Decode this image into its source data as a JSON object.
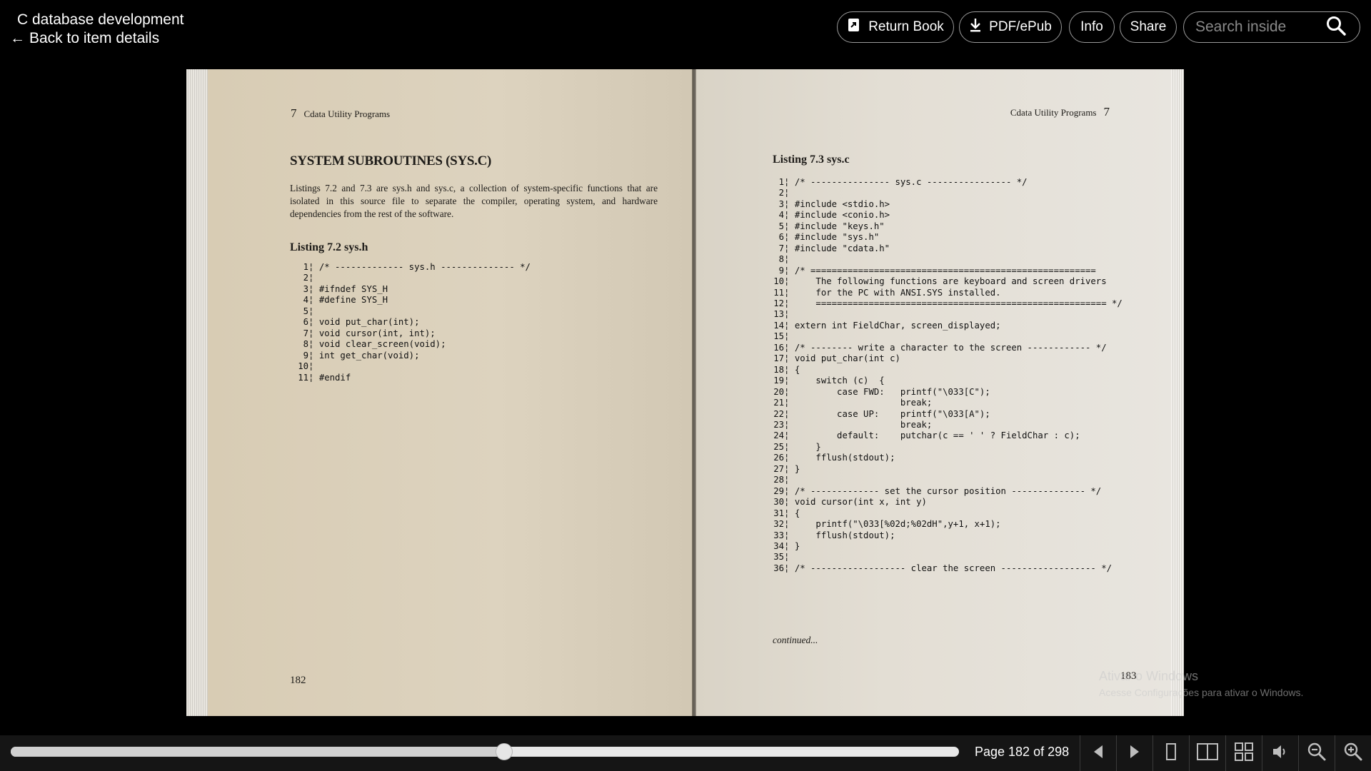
{
  "header": {
    "title": "C database development",
    "back_link": "Back to item details",
    "back_arrow": "←",
    "buttons": {
      "return_book": "Return Book",
      "pdf_epub": "PDF/ePub",
      "info": "Info",
      "share": "Share"
    },
    "search_placeholder": "Search inside"
  },
  "book": {
    "left_page": {
      "running_head_number": "7",
      "running_head": "Cdata Utility Programs",
      "section_title": "SYSTEM SUBROUTINES (SYS.C)",
      "paragraph": "Listings 7.2 and 7.3 are sys.h and sys.c, a collection of system-specific functions that are isolated in this source file to separate the compiler, operating system, and hardware dependencies from the rest of the software.",
      "listing_title": "Listing 7.2 sys.h",
      "code": [
        {
          "n": "1",
          "t": "/* ------------- sys.h -------------- */"
        },
        {
          "n": "2",
          "t": ""
        },
        {
          "n": "3",
          "t": "#ifndef SYS_H"
        },
        {
          "n": "4",
          "t": "#define SYS_H"
        },
        {
          "n": "5",
          "t": ""
        },
        {
          "n": "6",
          "t": "void put_char(int);"
        },
        {
          "n": "7",
          "t": "void cursor(int, int);"
        },
        {
          "n": "8",
          "t": "void clear_screen(void);"
        },
        {
          "n": "9",
          "t": "int get_char(void);"
        },
        {
          "n": "10",
          "t": ""
        },
        {
          "n": "11",
          "t": "#endif"
        }
      ],
      "folio": "182"
    },
    "right_page": {
      "running_head": "Cdata Utility Programs",
      "running_head_number": "7",
      "listing_title": "Listing 7.3 sys.c",
      "code": [
        {
          "n": "1",
          "t": "/* --------------- sys.c ---------------- */"
        },
        {
          "n": "2",
          "t": ""
        },
        {
          "n": "3",
          "t": "#include <stdio.h>"
        },
        {
          "n": "4",
          "t": "#include <conio.h>"
        },
        {
          "n": "5",
          "t": "#include \"keys.h\""
        },
        {
          "n": "6",
          "t": "#include \"sys.h\""
        },
        {
          "n": "7",
          "t": "#include \"cdata.h\""
        },
        {
          "n": "8",
          "t": ""
        },
        {
          "n": "9",
          "t": "/* ======================================================"
        },
        {
          "n": "10",
          "t": "    The following functions are keyboard and screen drivers"
        },
        {
          "n": "11",
          "t": "    for the PC with ANSI.SYS installed."
        },
        {
          "n": "12",
          "t": "    ======================================================= */"
        },
        {
          "n": "13",
          "t": ""
        },
        {
          "n": "14",
          "t": "extern int FieldChar, screen_displayed;"
        },
        {
          "n": "15",
          "t": ""
        },
        {
          "n": "16",
          "t": "/* -------- write a character to the screen ------------ */"
        },
        {
          "n": "17",
          "t": "void put_char(int c)"
        },
        {
          "n": "18",
          "t": "{"
        },
        {
          "n": "19",
          "t": "    switch (c)  {"
        },
        {
          "n": "20",
          "t": "        case FWD:   printf(\"\\033[C\");"
        },
        {
          "n": "21",
          "t": "                    break;"
        },
        {
          "n": "22",
          "t": "        case UP:    printf(\"\\033[A\");"
        },
        {
          "n": "23",
          "t": "                    break;"
        },
        {
          "n": "24",
          "t": "        default:    putchar(c == ' ' ? FieldChar : c);"
        },
        {
          "n": "25",
          "t": "    }"
        },
        {
          "n": "26",
          "t": "    fflush(stdout);"
        },
        {
          "n": "27",
          "t": "}"
        },
        {
          "n": "28",
          "t": ""
        },
        {
          "n": "29",
          "t": "/* ------------- set the cursor position -------------- */"
        },
        {
          "n": "30",
          "t": "void cursor(int x, int y)"
        },
        {
          "n": "31",
          "t": "{"
        },
        {
          "n": "32",
          "t": "    printf(\"\\033[%02d;%02dH\",y+1, x+1);"
        },
        {
          "n": "33",
          "t": "    fflush(stdout);"
        },
        {
          "n": "34",
          "t": "}"
        },
        {
          "n": "35",
          "t": ""
        },
        {
          "n": "36",
          "t": "/* ------------------ clear the screen ------------------ */"
        }
      ],
      "continued": "continued...",
      "folio": "183"
    }
  },
  "watermark": {
    "line1": "Ativar o Windows",
    "line2": "Acesse Configurações para ativar o Windows."
  },
  "bottom_bar": {
    "page_indicator": "Page 182 of 298",
    "progress_fraction": 0.52,
    "controls": [
      "previous-page-icon",
      "next-page-icon",
      "one-page-view-icon",
      "two-page-view-icon",
      "thumbnail-view-icon",
      "read-aloud-icon",
      "zoom-out-icon",
      "zoom-in-icon"
    ]
  },
  "colors": {
    "background": "#000000",
    "bottom_bar": "#151515",
    "page_left": "#ddd3bf",
    "page_right": "#e3ded4"
  }
}
